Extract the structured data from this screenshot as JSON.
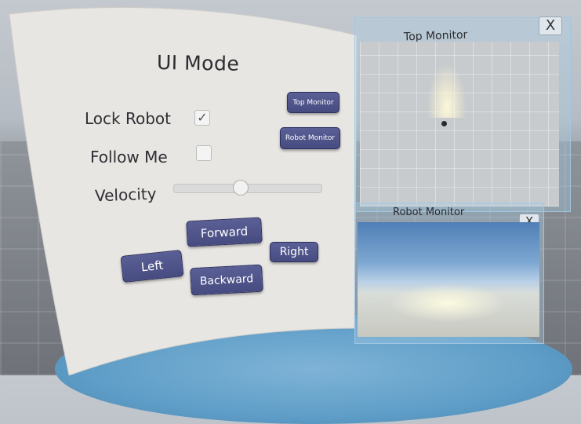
{
  "panel": {
    "title": "UI Mode"
  },
  "lock_robot": {
    "label": "Lock Robot",
    "checked": true,
    "mark": "✓"
  },
  "follow_me": {
    "label": "Follow Me",
    "checked": false
  },
  "velocity": {
    "label": "Velocity",
    "value": 0.45
  },
  "buttons": {
    "top_monitor": "Top Monitor",
    "robot_monitor": "Robot Monitor",
    "forward": "Forward",
    "left": "Left",
    "right": "Right",
    "backward": "Backward"
  },
  "top_monitor": {
    "title": "Top Monitor",
    "close": "X"
  },
  "robot_monitor": {
    "title": "Robot Monitor",
    "close": "X"
  },
  "colors": {
    "button": "#4f5489",
    "panel": "#e7e5e1",
    "monitor_frame": "#a8cbe6"
  }
}
